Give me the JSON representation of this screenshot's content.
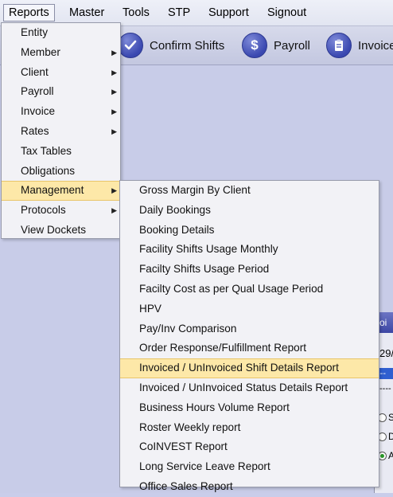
{
  "menubar": {
    "items": [
      "Reports",
      "Master",
      "Tools",
      "STP",
      "Support",
      "Signout"
    ]
  },
  "toolbar": {
    "confirm_shifts": "Confirm Shifts",
    "payroll": "Payroll",
    "invoice": "Invoice"
  },
  "reports_menu": {
    "items": [
      {
        "label": "Entity",
        "has_submenu": false
      },
      {
        "label": "Member",
        "has_submenu": true
      },
      {
        "label": "Client",
        "has_submenu": true
      },
      {
        "label": "Payroll",
        "has_submenu": true
      },
      {
        "label": "Invoice",
        "has_submenu": true
      },
      {
        "label": "Rates",
        "has_submenu": true
      },
      {
        "label": "Tax Tables",
        "has_submenu": false
      },
      {
        "label": "Obligations",
        "has_submenu": false
      },
      {
        "label": "Management",
        "has_submenu": true,
        "highlighted": true
      },
      {
        "label": "Protocols",
        "has_submenu": true
      },
      {
        "label": "View Dockets",
        "has_submenu": false
      }
    ]
  },
  "management_menu": {
    "items": [
      "Gross Margin By Client",
      "Daily Bookings",
      "Booking Details",
      "Facility Shifts Usage Monthly",
      "Facilty Shifts Usage Period",
      "Facilty Cost as per Qual Usage Period",
      "HPV",
      "Pay/Inv Comparison",
      "Order Response/Fulfillment Report",
      "Invoiced / UnInvoiced Shift Details Report",
      "Invoiced / UnInvoiced Status Details Report",
      "Business Hours Volume Report",
      "Roster Weekly report",
      "CoINVEST Report",
      "Long Service Leave Report",
      "Office Sales Report"
    ],
    "highlighted_index": 9
  },
  "side_panel": {
    "header": "voi",
    "date": "29/",
    "select": "---",
    "dash_line": "----",
    "radios": [
      {
        "label": "S",
        "checked": false
      },
      {
        "label": "D",
        "checked": false
      },
      {
        "label": "A",
        "checked": true
      }
    ]
  },
  "colors": {
    "highlight": "#fde8a8",
    "menu_bg": "#f2f2f6",
    "desktop": "#c8cce8"
  }
}
